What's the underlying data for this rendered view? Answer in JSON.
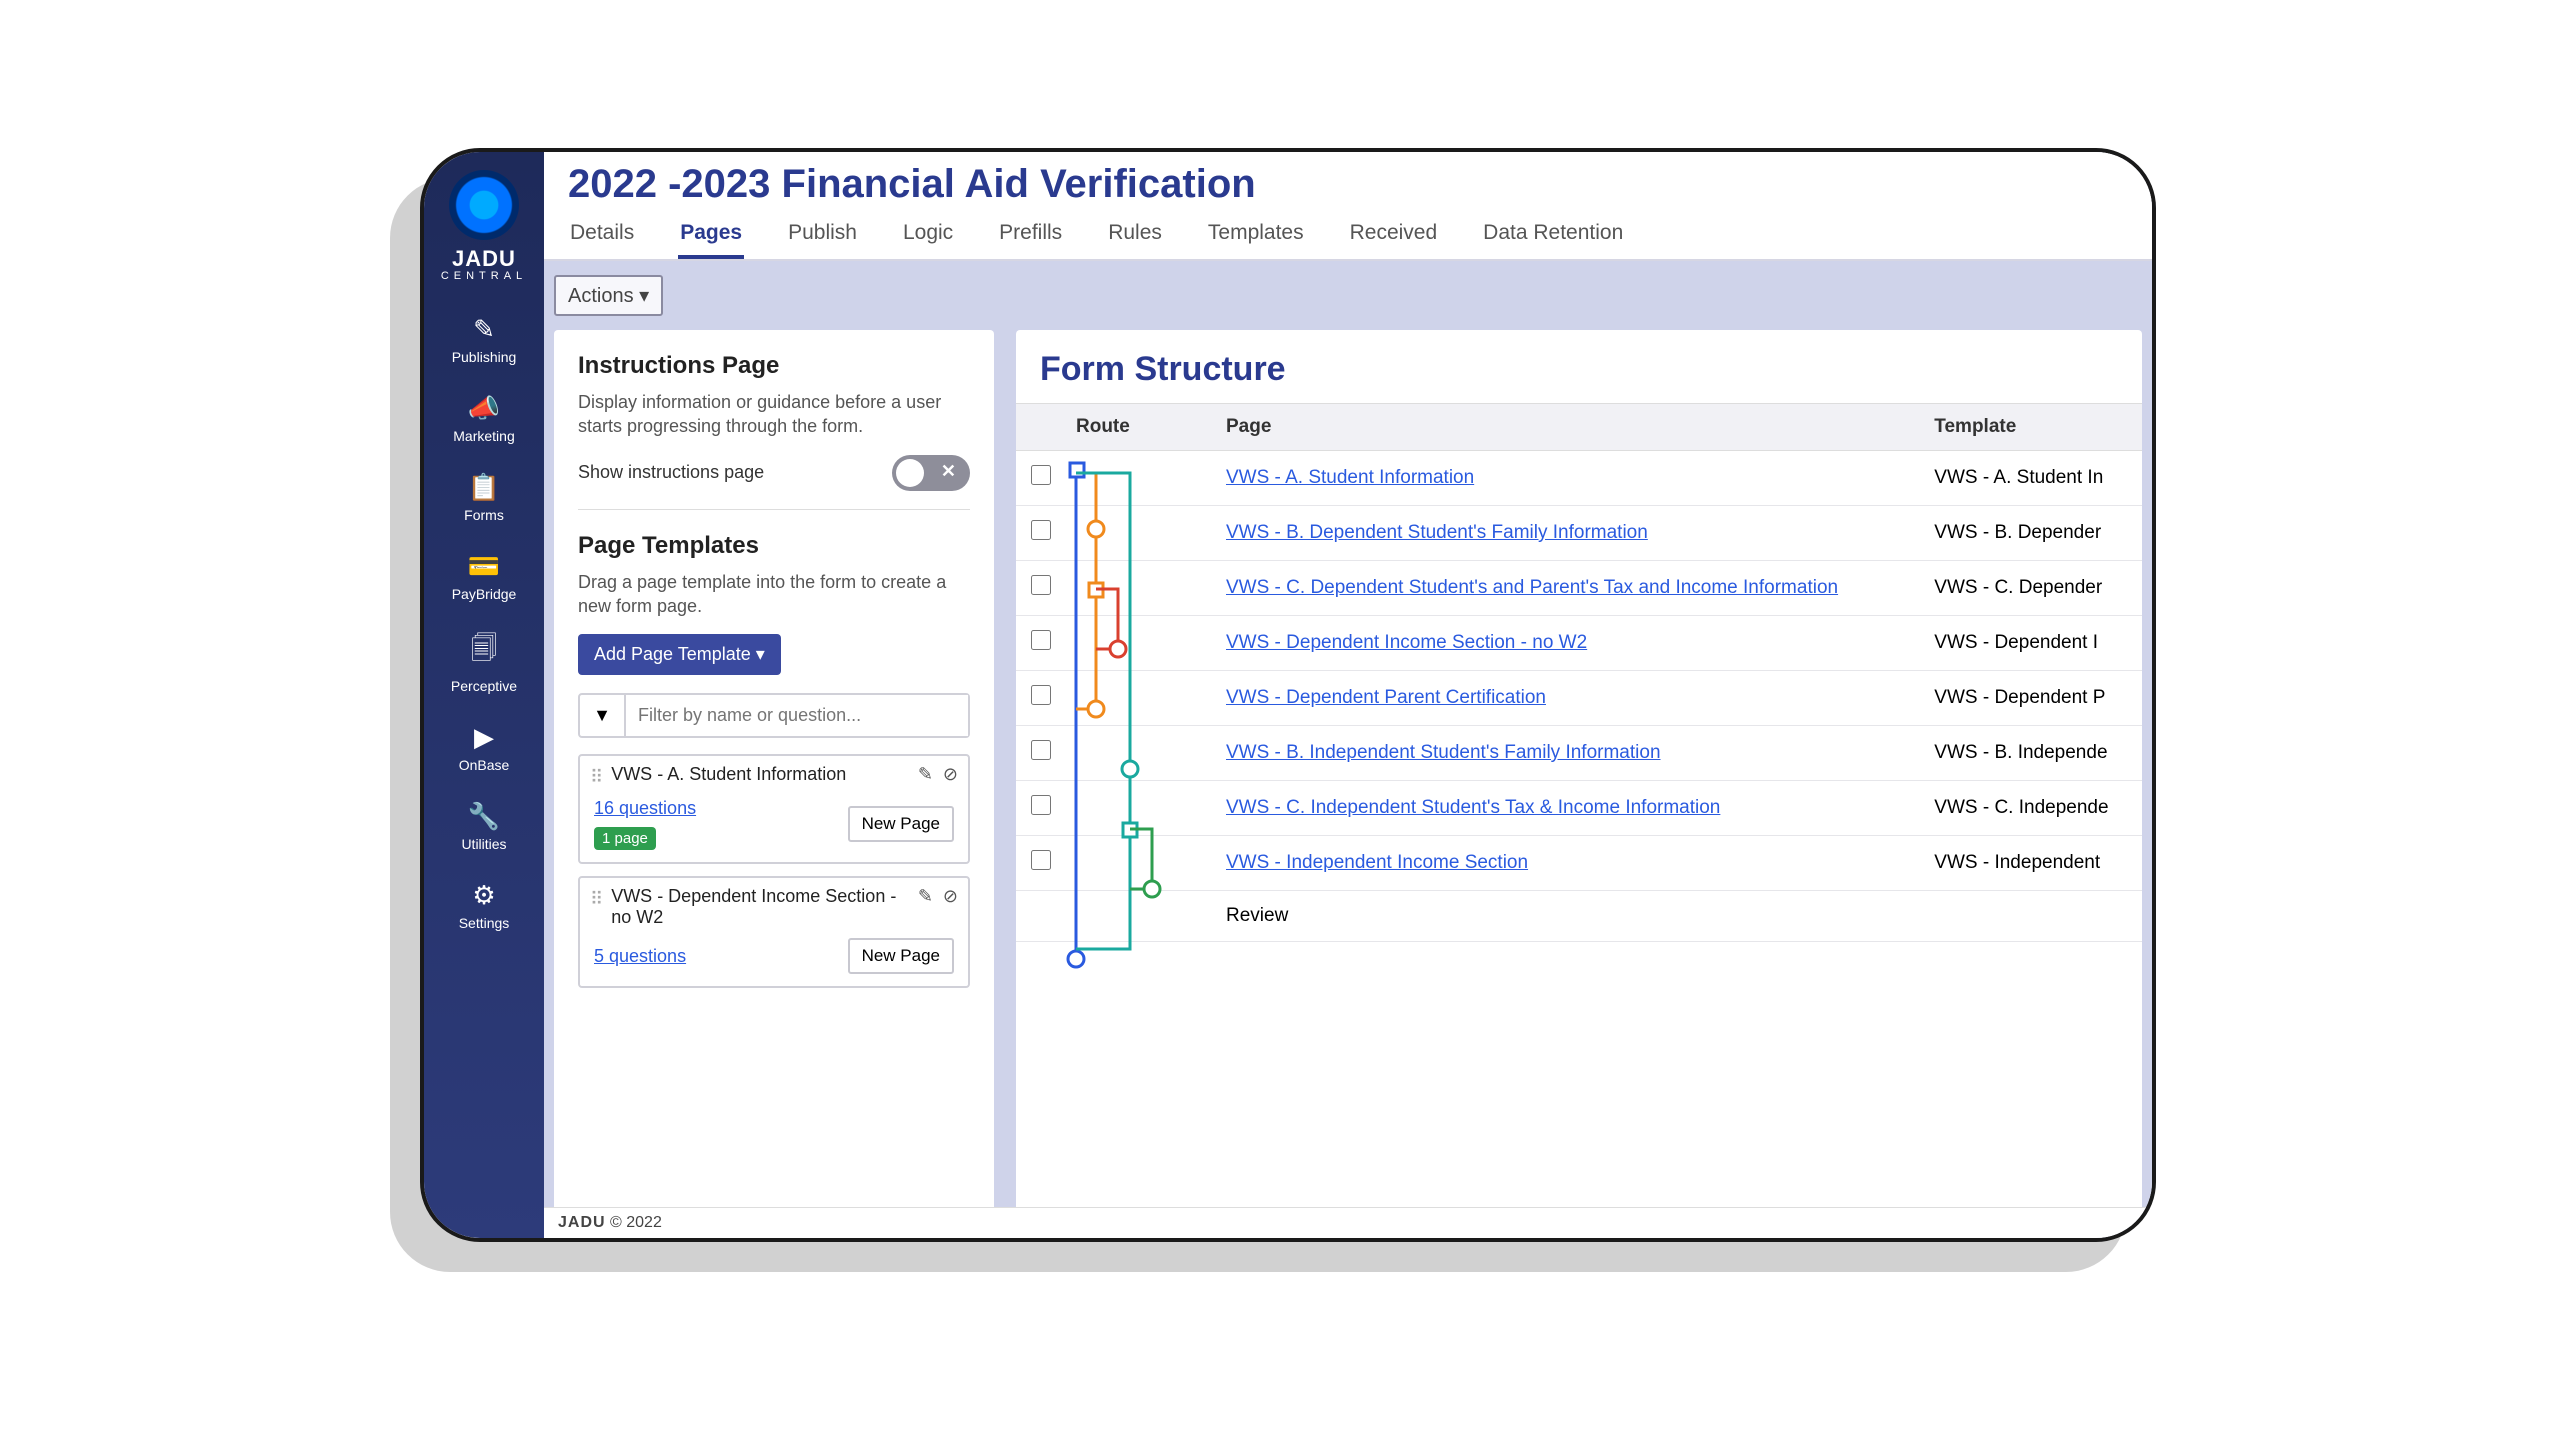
{
  "brand": {
    "name": "JADU",
    "sub": "CENTRAL"
  },
  "sidebar": {
    "items": [
      {
        "icon": "✎",
        "label": "Publishing"
      },
      {
        "icon": "📣",
        "label": "Marketing"
      },
      {
        "icon": "📋",
        "label": "Forms"
      },
      {
        "icon": "💳",
        "label": "PayBridge"
      },
      {
        "icon": "🗐",
        "label": "Perceptive"
      },
      {
        "icon": "▶",
        "label": "OnBase"
      },
      {
        "icon": "🔧",
        "label": "Utilities"
      },
      {
        "icon": "⚙",
        "label": "Settings"
      }
    ]
  },
  "page_title": "2022 -2023 Financial Aid Verification",
  "tabs": [
    "Details",
    "Pages",
    "Publish",
    "Logic",
    "Prefills",
    "Rules",
    "Templates",
    "Received",
    "Data Retention"
  ],
  "active_tab_index": 1,
  "actions_label": "Actions ▾",
  "instructions": {
    "heading": "Instructions Page",
    "desc": "Display information or guidance before a user starts progressing through the form.",
    "toggle_label": "Show instructions page",
    "toggle_on": false
  },
  "templates": {
    "heading": "Page Templates",
    "desc": "Drag a page template into the form to create a new form page.",
    "add_btn": "Add Page Template ▾",
    "filter_placeholder": "Filter by name or question...",
    "cards": [
      {
        "name": "VWS - A. Student Information",
        "questions": "16 questions",
        "badge": "1 page",
        "new_page": "New Page"
      },
      {
        "name": "VWS - Dependent Income Section - no W2",
        "questions": "5 questions",
        "badge": "",
        "new_page": "New Page"
      }
    ]
  },
  "form_structure": {
    "heading": "Form Structure",
    "columns": {
      "route": "Route",
      "page": "Page",
      "template": "Template"
    },
    "rows": [
      {
        "page": "VWS - A. Student Information",
        "template": "VWS - A. Student In",
        "link": true
      },
      {
        "page": "VWS - B. Dependent Student's Family Information",
        "template": "VWS - B. Depender",
        "link": true
      },
      {
        "page": "VWS - C. Dependent Student's and Parent's Tax and Income Information",
        "template": "VWS - C. Depender",
        "link": true
      },
      {
        "page": "VWS - Dependent Income Section - no W2",
        "template": "VWS - Dependent I",
        "link": true
      },
      {
        "page": "VWS - Dependent Parent Certification",
        "template": "VWS - Dependent P",
        "link": true
      },
      {
        "page": "VWS - B. Independent Student's Family Information",
        "template": "VWS - B. Independe",
        "link": true
      },
      {
        "page": "VWS - C. Independent Student's Tax & Income Information",
        "template": "VWS - C. Independe",
        "link": true
      },
      {
        "page": "VWS - Independent Income Section",
        "template": "VWS - Independent",
        "link": true
      },
      {
        "page": "Review",
        "template": "",
        "link": false
      }
    ]
  },
  "footer": {
    "brand": "JADU",
    "rest": " © 2022"
  }
}
